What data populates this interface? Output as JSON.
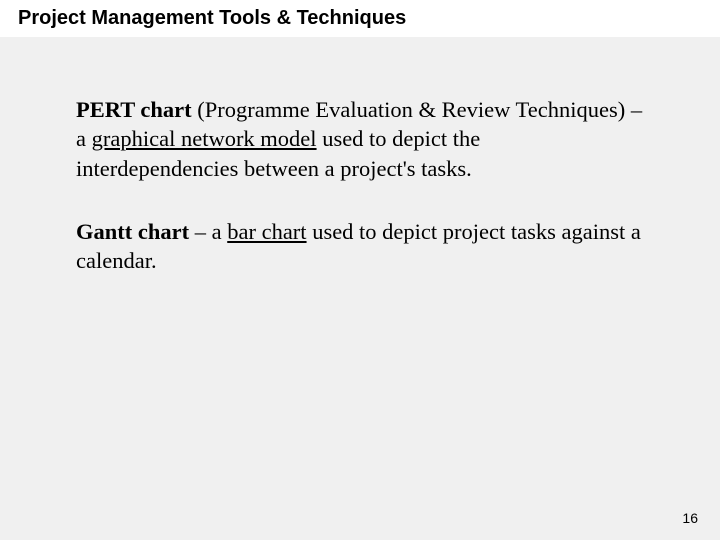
{
  "title": "Project Management Tools & Techniques",
  "para1": {
    "bold": "PERT chart",
    "pre": " (Programme Evaluation & Review Techniques) – a ",
    "underline": "graphical network model",
    "post": " used to depict the interdependencies between a project's tasks."
  },
  "para2": {
    "bold": "Gantt chart",
    "pre": "  – a ",
    "underline": "bar chart",
    "post": " used to depict project tasks against a calendar."
  },
  "page_number": "16"
}
